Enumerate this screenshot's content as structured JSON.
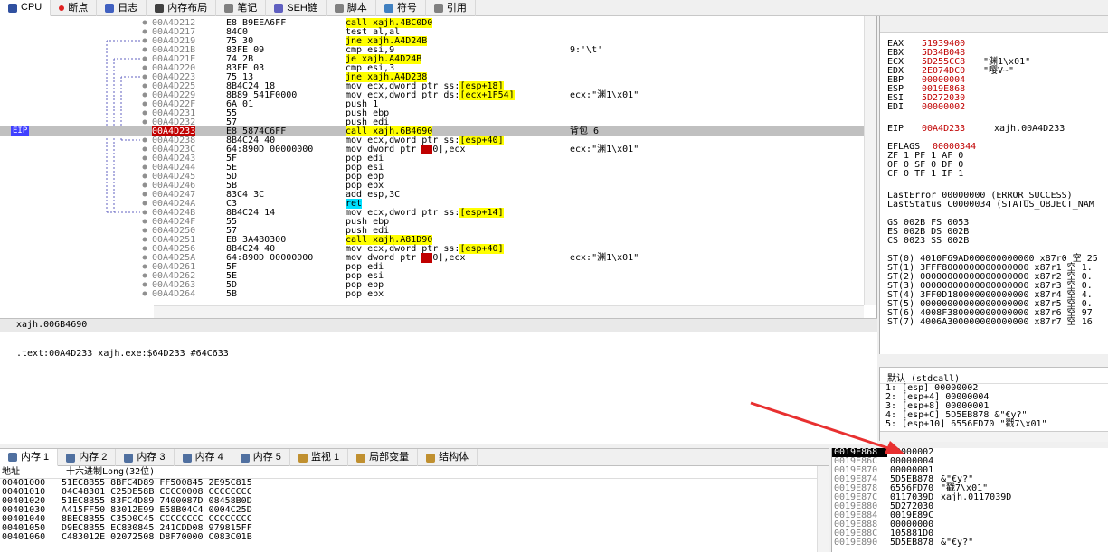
{
  "tabs": [
    {
      "label": "CPU",
      "icon": "cpu-icon",
      "color": "#3050a0",
      "active": true
    },
    {
      "label": "断点",
      "icon": "breakpoint-dot-icon",
      "color": "#e02020"
    },
    {
      "label": "日志",
      "icon": "log-icon",
      "color": "#4060c0"
    },
    {
      "label": "内存布局",
      "icon": "memory-map-icon",
      "color": "#404040"
    },
    {
      "label": "笔记",
      "icon": "notes-icon",
      "color": "#808080"
    },
    {
      "label": "SEH链",
      "icon": "seh-chain-icon",
      "color": "#6060c0"
    },
    {
      "label": "脚本",
      "icon": "script-icon",
      "color": "#808080"
    },
    {
      "label": "符号",
      "icon": "symbols-icon",
      "color": "#4080c0"
    },
    {
      "label": "引用",
      "icon": "references-icon",
      "color": "#808080"
    }
  ],
  "disasm": {
    "eip_label": "EIP",
    "rows": [
      {
        "addr": "00A4D212",
        "bytes": "E8 B9EEA6FF",
        "instr": "call xajh.4BC0D0",
        "style": "call",
        "cmt": ""
      },
      {
        "addr": "00A4D217",
        "bytes": "84C0",
        "instr": "test al,al",
        "style": "",
        "cmt": ""
      },
      {
        "addr": "00A4D219",
        "bytes": "75 30",
        "instr": "jne xajh.A4D24B",
        "style": "jmp",
        "cmt": ""
      },
      {
        "addr": "00A4D21B",
        "bytes": "83FE 09",
        "instr": "cmp esi,9",
        "style": "",
        "cmt": "9:'\\t'"
      },
      {
        "addr": "00A4D21E",
        "bytes": "74 2B",
        "instr": "je xajh.A4D24B",
        "style": "jmp",
        "cmt": ""
      },
      {
        "addr": "00A4D220",
        "bytes": "83FE 03",
        "instr": "cmp esi,3",
        "style": "",
        "cmt": ""
      },
      {
        "addr": "00A4D223",
        "bytes": "75 13",
        "instr": "jne xajh.A4D238",
        "style": "jmp",
        "cmt": ""
      },
      {
        "addr": "00A4D225",
        "bytes": "8B4C24 18",
        "instr": "mov ecx,dword ptr ss:[esp+18]",
        "style": "mem",
        "cmt": ""
      },
      {
        "addr": "00A4D229",
        "bytes": "8B89 541F0000",
        "instr": "mov ecx,dword ptr ds:[ecx+1F54]",
        "style": "mem",
        "cmt": "ecx:\"渊1\\x01\""
      },
      {
        "addr": "00A4D22F",
        "bytes": "6A 01",
        "instr": "push 1",
        "style": "",
        "cmt": ""
      },
      {
        "addr": "00A4D231",
        "bytes": "55",
        "instr": "push ebp",
        "style": "",
        "cmt": ""
      },
      {
        "addr": "00A4D232",
        "bytes": "57",
        "instr": "push edi",
        "style": "",
        "cmt": ""
      },
      {
        "addr": "00A4D233",
        "bytes": "E8 5874C6FF",
        "instr": "call xajh.6B4690",
        "style": "call",
        "cmt": "背包 6",
        "eip": true
      },
      {
        "addr": "00A4D238",
        "bytes": "8B4C24 40",
        "instr": "mov ecx,dword ptr ss:[esp+40]",
        "style": "mem",
        "cmt": ""
      },
      {
        "addr": "00A4D23C",
        "bytes": "64:890D 00000000",
        "instr": "mov dword ptr fs:[0],ecx",
        "style": "fs",
        "cmt": "ecx:\"渊1\\x01\""
      },
      {
        "addr": "00A4D243",
        "bytes": "5F",
        "instr": "pop edi",
        "style": "",
        "cmt": ""
      },
      {
        "addr": "00A4D244",
        "bytes": "5E",
        "instr": "pop esi",
        "style": "",
        "cmt": ""
      },
      {
        "addr": "00A4D245",
        "bytes": "5D",
        "instr": "pop ebp",
        "style": "",
        "cmt": ""
      },
      {
        "addr": "00A4D246",
        "bytes": "5B",
        "instr": "pop ebx",
        "style": "",
        "cmt": ""
      },
      {
        "addr": "00A4D247",
        "bytes": "83C4 3C",
        "instr": "add esp,3C",
        "style": "",
        "cmt": ""
      },
      {
        "addr": "00A4D24A",
        "bytes": "C3",
        "instr": "ret",
        "style": "ret",
        "cmt": ""
      },
      {
        "addr": "00A4D24B",
        "bytes": "8B4C24 14",
        "instr": "mov ecx,dword ptr ss:[esp+14]",
        "style": "mem",
        "cmt": ""
      },
      {
        "addr": "00A4D24F",
        "bytes": "55",
        "instr": "push ebp",
        "style": "",
        "cmt": ""
      },
      {
        "addr": "00A4D250",
        "bytes": "57",
        "instr": "push edi",
        "style": "",
        "cmt": ""
      },
      {
        "addr": "00A4D251",
        "bytes": "E8 3A4B0300",
        "instr": "call xajh.A81D90",
        "style": "call",
        "cmt": ""
      },
      {
        "addr": "00A4D256",
        "bytes": "8B4C24 40",
        "instr": "mov ecx,dword ptr ss:[esp+40]",
        "style": "mem",
        "cmt": ""
      },
      {
        "addr": "00A4D25A",
        "bytes": "64:890D 00000000",
        "instr": "mov dword ptr fs:[0],ecx",
        "style": "fs",
        "cmt": "ecx:\"渊1\\x01\""
      },
      {
        "addr": "00A4D261",
        "bytes": "5F",
        "instr": "pop edi",
        "style": "",
        "cmt": ""
      },
      {
        "addr": "00A4D262",
        "bytes": "5E",
        "instr": "pop esi",
        "style": "",
        "cmt": ""
      },
      {
        "addr": "00A4D263",
        "bytes": "5D",
        "instr": "pop ebp",
        "style": "",
        "cmt": ""
      },
      {
        "addr": "00A4D264",
        "bytes": "5B",
        "instr": "pop ebx",
        "style": "",
        "cmt": ""
      }
    ]
  },
  "info": {
    "line1": "xajh.006B4690",
    "line2": ".text:00A4D233 xajh.exe:$64D233 #64C633"
  },
  "regs": {
    "gp": [
      {
        "name": "EAX",
        "value": "51939400",
        "cmt": ""
      },
      {
        "name": "EBX",
        "value": "5D34B048",
        "cmt": ""
      },
      {
        "name": "ECX",
        "value": "5D255CC8",
        "cmt": "\"渊1\\x01\""
      },
      {
        "name": "EDX",
        "value": "2E074DC0",
        "cmt": "\"嘤V~\""
      },
      {
        "name": "EBP",
        "value": "00000004",
        "cmt": ""
      },
      {
        "name": "ESP",
        "value": "0019E868",
        "cmt": ""
      },
      {
        "name": "ESI",
        "value": "5D272030",
        "cmt": ""
      },
      {
        "name": "EDI",
        "value": "00000002",
        "cmt": ""
      }
    ],
    "eip": {
      "name": "EIP",
      "value": "00A4D233",
      "cmt": "xajh.00A4D233"
    },
    "eflags": {
      "name": "EFLAGS",
      "value": "00000344"
    },
    "flags": [
      "ZF 1  PF 1  AF 0",
      "OF 0  SF 0  DF 0",
      "CF 0  TF 1  IF 1"
    ],
    "lasterror": "LastError  00000000 (ERROR_SUCCESS)",
    "laststatus": "LastStatus C0000034 (STATUS_OBJECT_NAM",
    "segs": [
      "GS 002B  FS 0053",
      "ES 002B  DS 002B",
      "CS 0023  SS 002B"
    ],
    "fpu": [
      "ST(0) 4010F69AD000000000000 x87r0 空 25",
      "ST(1) 3FFF8000000000000000 x87r1 空 1.",
      "ST(2) 00000000000000000000 x87r2 空 0.",
      "ST(3) 00000000000000000000 x87r3 空 0.",
      "ST(4) 3FF0D180000000000000 x87r4 空 4.",
      "ST(5) 00000000000000000000 x87r5 空 0.",
      "ST(6) 4008F380000000000000 x87r6 空 97",
      "ST(7) 4006A300000000000000 x87r7 空 16"
    ]
  },
  "stackargs": {
    "header": "默认 (stdcall)",
    "lines": [
      "1: [esp] 00000002",
      "2: [esp+4] 00000004",
      "3: [esp+8] 00000001",
      "4: [esp+C] 5D5EB878 &\"€y?\"",
      "5: [esp+10] 6556FD70 \"戳7\\x01\""
    ]
  },
  "dumptabs": [
    {
      "label": "内存 1",
      "active": true
    },
    {
      "label": "内存 2"
    },
    {
      "label": "内存 3"
    },
    {
      "label": "内存 4"
    },
    {
      "label": "内存 5"
    },
    {
      "label": "监视 1",
      "icon": "watch-icon"
    },
    {
      "label": "局部变量",
      "icon": "locals-icon"
    },
    {
      "label": "结构体",
      "icon": "struct-icon"
    }
  ],
  "dump": {
    "col_addr": "地址",
    "col_hex": "十六进制Long(32位)",
    "rows": [
      {
        "addr": "00401000",
        "hex": "51EC8B55 8BFC4D89 FF500845 2E95C815"
      },
      {
        "addr": "00401010",
        "hex": "04C48301 C25DE58B CCCC0008 CCCCCCCC"
      },
      {
        "addr": "00401020",
        "hex": "51EC8B55 83FC4D89 7400087D 08458B0D"
      },
      {
        "addr": "00401030",
        "hex": "A415FF50 83012E99 E58B04C4 0004C25D"
      },
      {
        "addr": "00401040",
        "hex": "8BEC8B55 C35D0C45 CCCCCCCC CCCCCCCC"
      },
      {
        "addr": "00401050",
        "hex": "D9EC8B55 EC830845 241CDD08 979815FF"
      },
      {
        "addr": "00401060",
        "hex": "C483012E 02072508 D8F70000 C083C01B"
      }
    ]
  },
  "stack": [
    {
      "addr": "0019E868",
      "val": "00000002",
      "cmt": "",
      "cur": true
    },
    {
      "addr": "0019E86C",
      "val": "00000004",
      "cmt": ""
    },
    {
      "addr": "0019E870",
      "val": "00000001",
      "cmt": ""
    },
    {
      "addr": "0019E874",
      "val": "5D5EB878",
      "cmt": "&\"€y?\""
    },
    {
      "addr": "0019E878",
      "val": "6556FD70",
      "cmt": "\"戳7\\x01\""
    },
    {
      "addr": "0019E87C",
      "val": "0117039D",
      "cmt": "xajh.0117039D"
    },
    {
      "addr": "0019E880",
      "val": "5D272030",
      "cmt": ""
    },
    {
      "addr": "0019E884",
      "val": "0019E89C",
      "cmt": ""
    },
    {
      "addr": "0019E888",
      "val": "00000000",
      "cmt": ""
    },
    {
      "addr": "0019E88C",
      "val": "105881D0",
      "cmt": ""
    },
    {
      "addr": "0019E890",
      "val": "5D5EB878",
      "cmt": "&\"€y?\""
    }
  ]
}
